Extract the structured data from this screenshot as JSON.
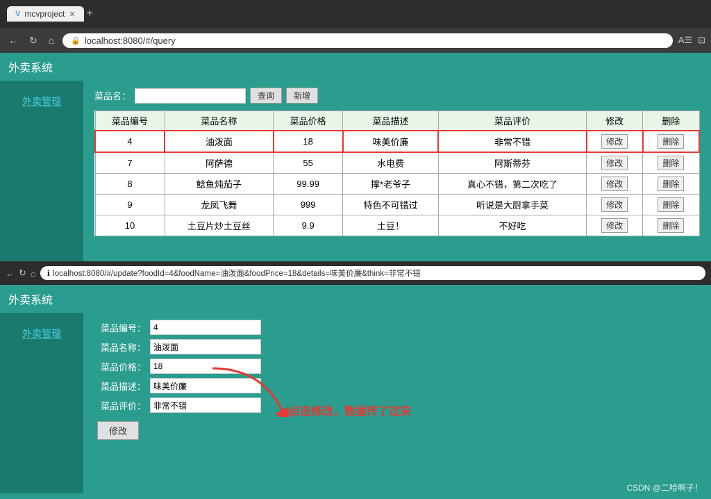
{
  "browser1": {
    "tab_title": "mcvproject",
    "url": "localhost:8080/#/query",
    "nav_back": "←",
    "nav_refresh": "↻",
    "nav_home": "⌂"
  },
  "browser2": {
    "url": "localhost:8080/#/update?foodId=4&foodName=油泼面&foodPrice=18&details=味美价廉&think=非常不错",
    "nav_back": "←",
    "nav_refresh": "↻",
    "nav_home": "⌂"
  },
  "system": {
    "title": "外卖系统"
  },
  "sidebar": {
    "link": "外卖管理"
  },
  "query_page": {
    "search_label": "菜品名：",
    "search_placeholder": "",
    "btn_query": "查询",
    "btn_add": "新增",
    "table": {
      "headers": [
        "菜品编号",
        "菜品名称",
        "菜品价格",
        "菜品描述",
        "菜品评价",
        "修改",
        "删除"
      ],
      "rows": [
        {
          "id": "4",
          "name": "油泼面",
          "price": "18",
          "desc": "味美价廉",
          "review": "非常不错",
          "highlighted": true
        },
        {
          "id": "7",
          "name": "阿萨德",
          "price": "55",
          "desc": "水电费",
          "review": "阿斯蒂芬",
          "highlighted": false
        },
        {
          "id": "8",
          "name": "鲶鱼炖茄子",
          "price": "99.99",
          "desc": "撑*老爷子",
          "review": "真心不错，第二次吃了",
          "highlighted": false
        },
        {
          "id": "9",
          "name": "龙凤飞舞",
          "price": "999",
          "desc": "特色不可错过",
          "review": "听说是大厨拿手菜",
          "highlighted": false
        },
        {
          "id": "10",
          "name": "土豆片炒土豆丝",
          "price": "9.9",
          "desc": "土豆！",
          "review": "不好吃",
          "highlighted": false
        }
      ],
      "btn_modify": "修改",
      "btn_delete": "删除"
    }
  },
  "update_page": {
    "fields": [
      {
        "label": "菜品编号：",
        "value": "4"
      },
      {
        "label": "菜品名称：",
        "value": "油泼面"
      },
      {
        "label": "菜品价格：",
        "value": "18"
      },
      {
        "label": "菜品描述：",
        "value": "味美价廉"
      },
      {
        "label": "菜品评价：",
        "value": "非常不错"
      }
    ],
    "btn_submit": "修改",
    "annotation": "点击修改，数据传了过来"
  },
  "csdn": {
    "watermark": "CSDN @二哈啊子！"
  }
}
